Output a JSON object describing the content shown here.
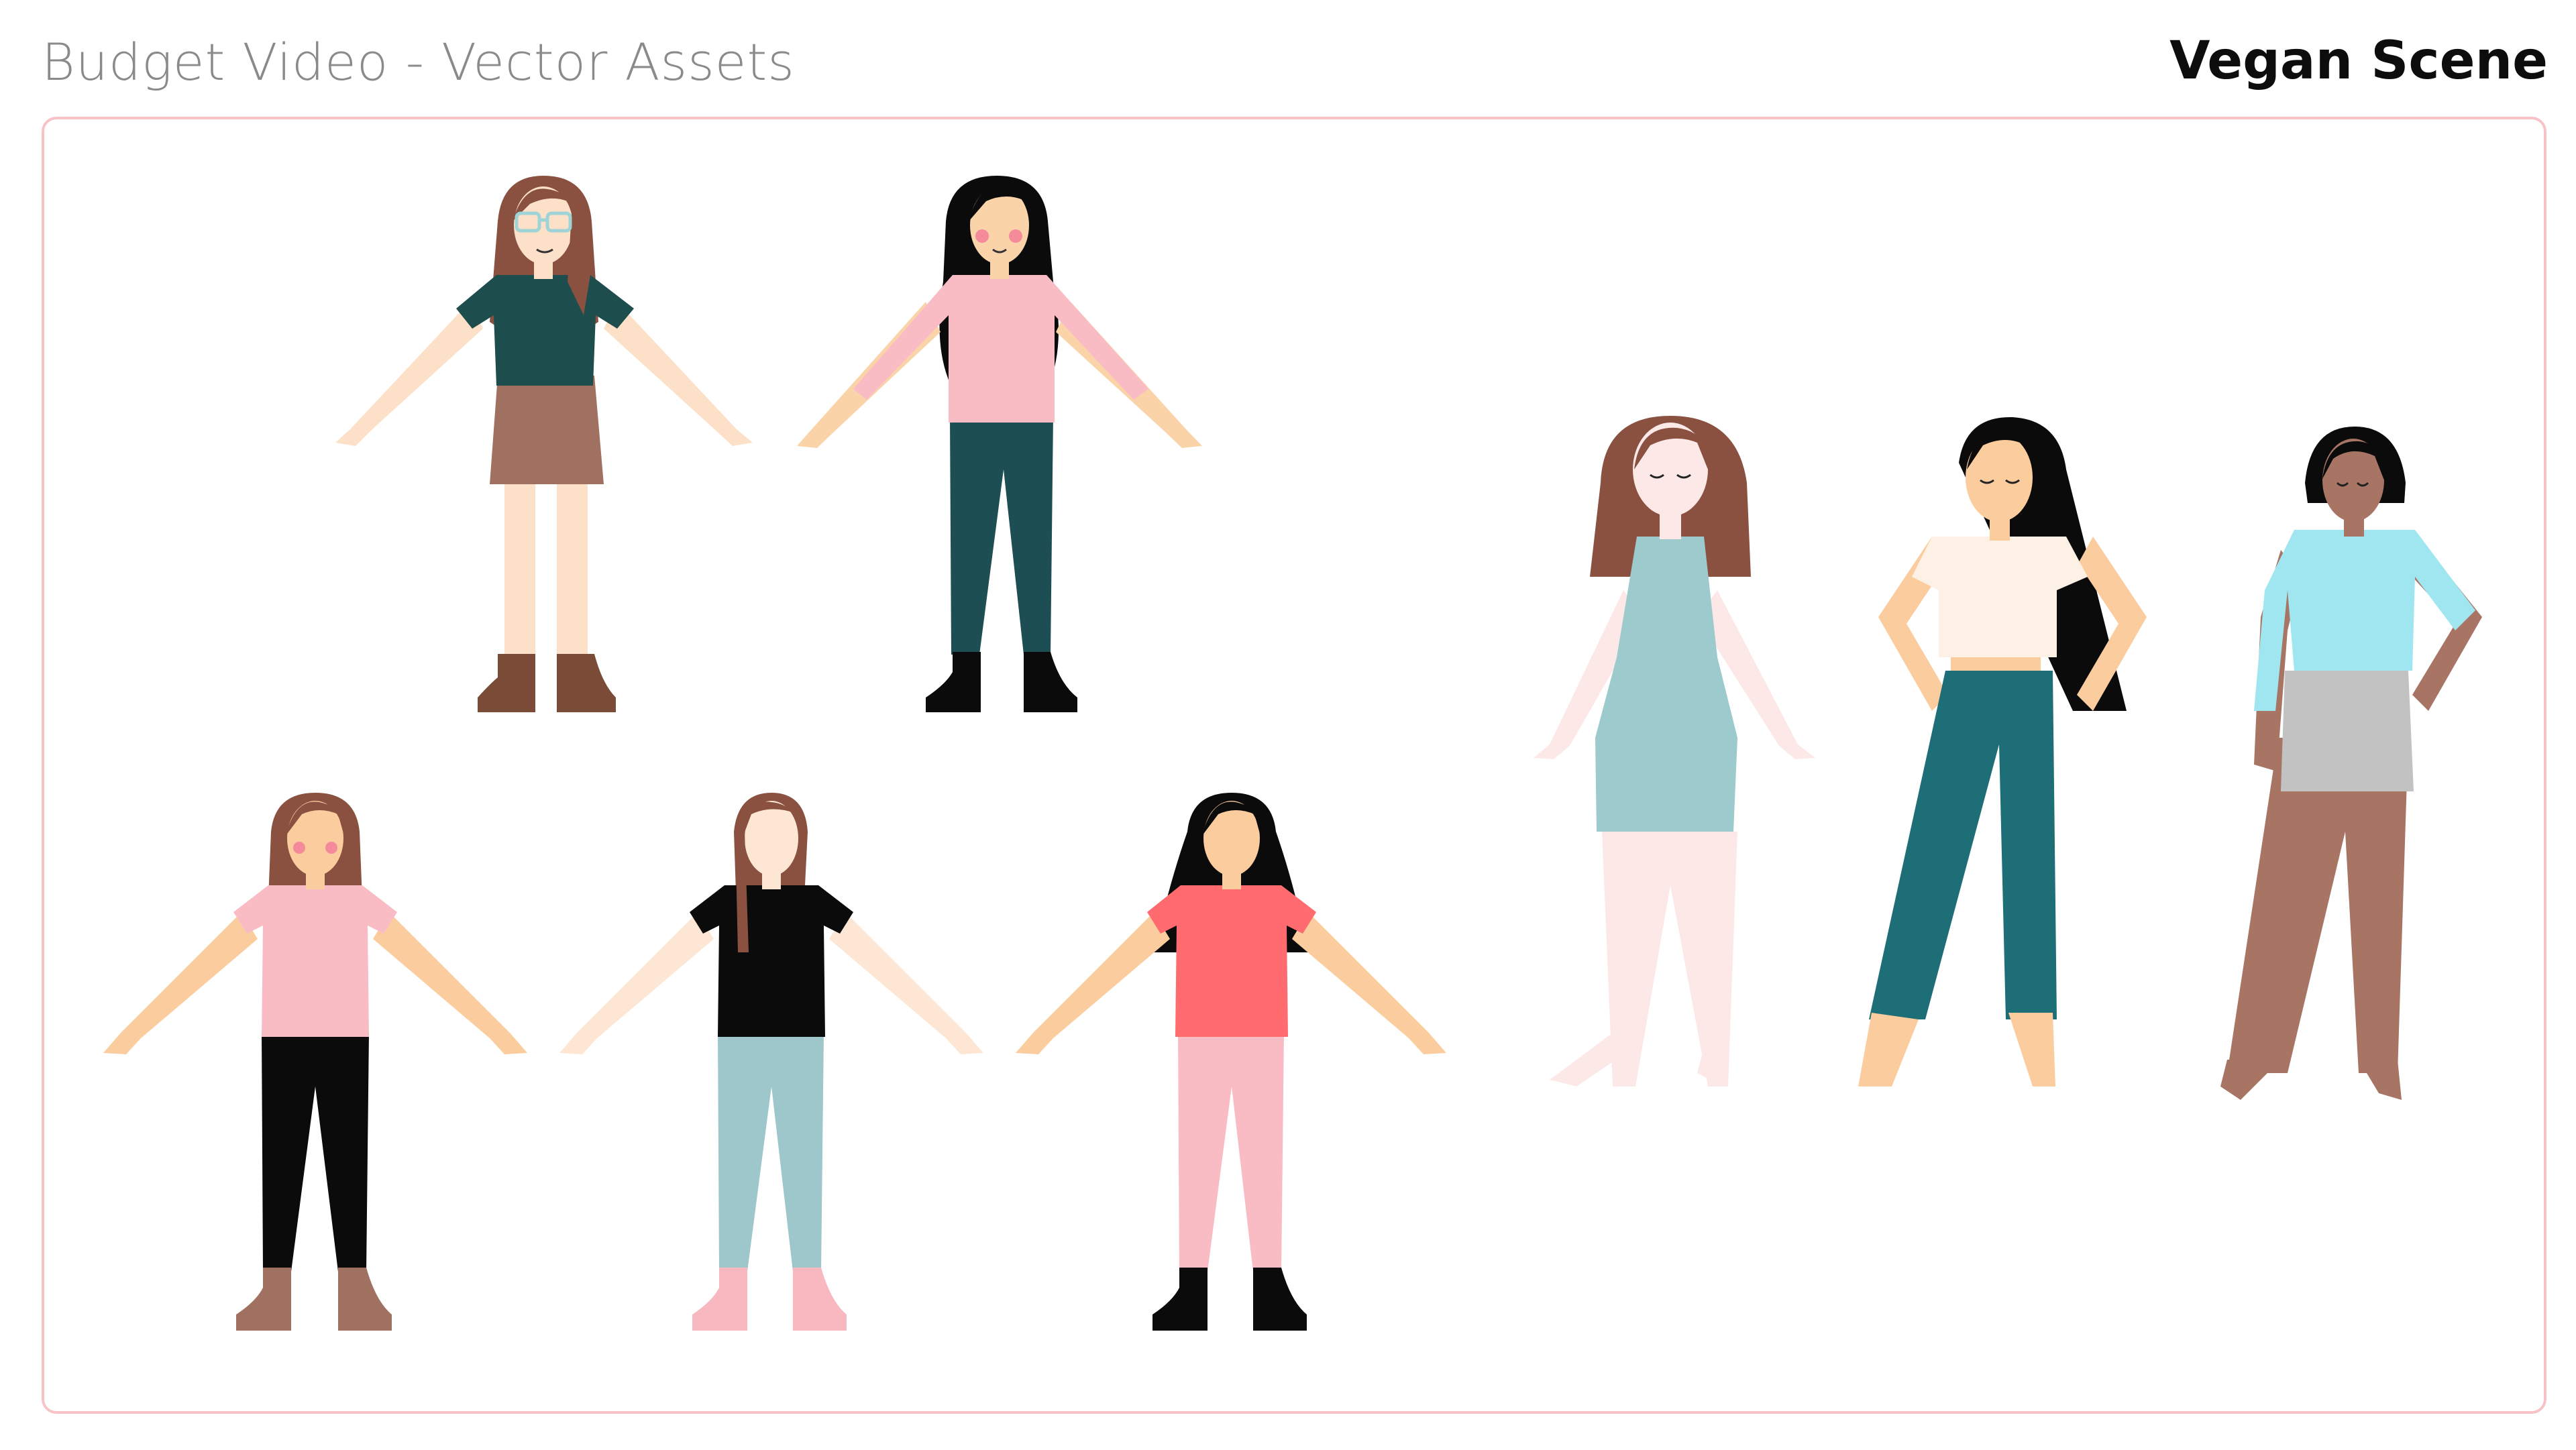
{
  "header": {
    "title": "Budget Video - Vector Assets",
    "scene_label": "Vegan Scene"
  },
  "characters": [
    {
      "name": "character-brown-hair-glasses",
      "pose": "a-pose",
      "hair": "#8a5140",
      "top": "#1e4d4e",
      "bottom": "#a07060",
      "bottom_type": "skirt",
      "shoes": "#7a4c38",
      "skin": "#fde0c8",
      "glasses": true,
      "blush": false
    },
    {
      "name": "character-black-hair-pink-top",
      "pose": "a-pose",
      "hair": "#0b0b0b",
      "top": "#f9bcc4",
      "bottom": "#1d4e53",
      "bottom_type": "pants",
      "shoes": "#0b0b0b",
      "skin": "#fbd3a8",
      "glasses": false,
      "blush": true
    },
    {
      "name": "character-brown-hair-pink-top-black-pants",
      "pose": "a-pose",
      "hair": "#8a5140",
      "top": "#f9bcc4",
      "bottom": "#0b0b0b",
      "bottom_type": "pants",
      "shoes": "#a07060",
      "skin": "#fbcd9e",
      "glasses": false,
      "blush": true
    },
    {
      "name": "character-brown-hair-black-top-light-jeans",
      "pose": "a-pose",
      "hair": "#8a5140",
      "top": "#0b0b0b",
      "bottom": "#9ec7cc",
      "bottom_type": "pants",
      "shoes": "#f8b8c0",
      "skin": "#fde7d4",
      "glasses": false,
      "blush": false
    },
    {
      "name": "character-black-hair-coral-top",
      "pose": "a-pose",
      "hair": "#0b0b0b",
      "top": "#ff6b6f",
      "bottom": "#f9bcc4",
      "bottom_type": "pants",
      "shoes": "#0b0b0b",
      "skin": "#fbcd9e",
      "glasses": false,
      "blush": false
    },
    {
      "name": "character-brown-hair-blue-dress",
      "pose": "dress",
      "hair": "#8a5140",
      "top": "#9ccacd",
      "bottom": "#9ccacd",
      "bottom_type": "dress",
      "shoes": "#fde8e8",
      "skin": "#fde8e8",
      "glasses": false,
      "blush": false
    },
    {
      "name": "character-black-hair-teal-jeans",
      "pose": "hands-on-hips",
      "hair": "#0b0b0b",
      "top": "#fdf1e6",
      "bottom": "#1e6e78",
      "bottom_type": "pants",
      "shoes": "#fbcd9e",
      "skin": "#fbcd9e",
      "glasses": false,
      "blush": false
    },
    {
      "name": "character-dark-skin-blue-sweater",
      "pose": "hands-on-hips",
      "hair": "#0b0b0b",
      "top": "#9fe6f0",
      "bottom": "#c2c2c2",
      "bottom_type": "shorts",
      "shoes": "#a87565",
      "skin": "#a87565",
      "glasses": false,
      "blush": false
    }
  ]
}
